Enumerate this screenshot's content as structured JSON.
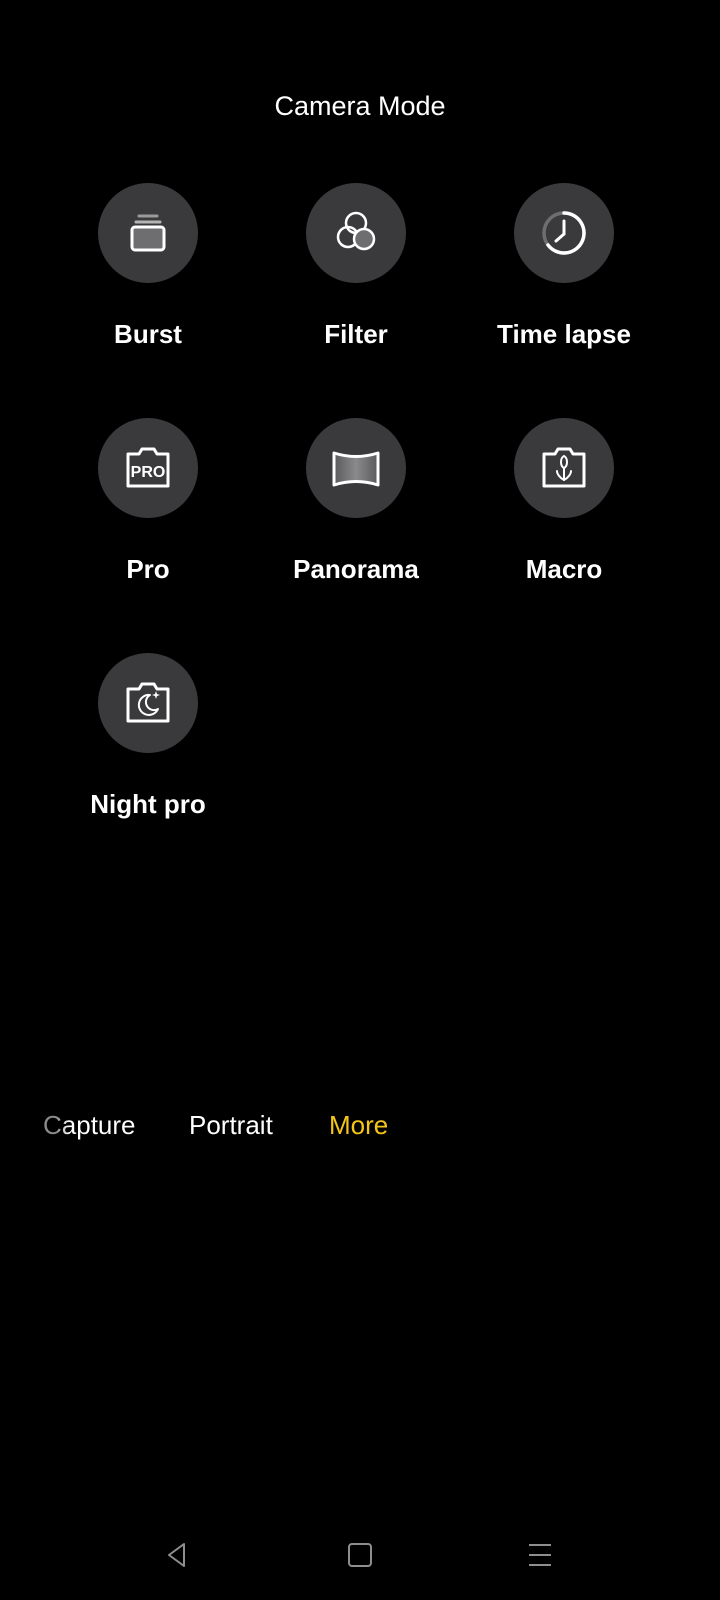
{
  "header": {
    "title": "Camera Mode"
  },
  "modes": [
    {
      "label": "Burst",
      "icon": "burst-icon"
    },
    {
      "label": "Filter",
      "icon": "filter-icon"
    },
    {
      "label": "Time lapse",
      "icon": "time-lapse-icon"
    },
    {
      "label": "Pro",
      "icon": "pro-camera-icon",
      "icon_text": "PRO"
    },
    {
      "label": "Panorama",
      "icon": "panorama-icon"
    },
    {
      "label": "Macro",
      "icon": "macro-icon"
    },
    {
      "label": "Night pro",
      "icon": "night-camera-icon"
    }
  ],
  "tabs": [
    {
      "label": "Capture",
      "active": false
    },
    {
      "label": "Portrait",
      "active": false
    },
    {
      "label": "More",
      "active": true
    }
  ],
  "navbar": {
    "back": "back-icon",
    "home": "home-icon",
    "menu": "menu-icon"
  },
  "colors": {
    "background": "#000000",
    "icon_circle": "#3a3a3c",
    "active_tab": "#f5c518",
    "text": "#ffffff"
  }
}
